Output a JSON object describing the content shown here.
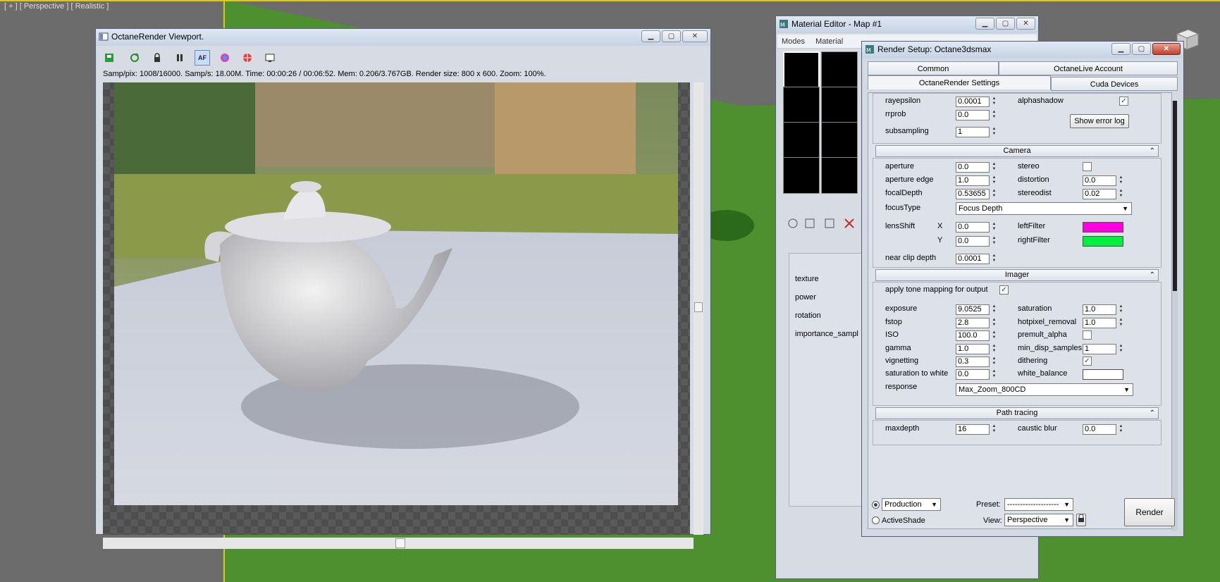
{
  "viewport": {
    "label": "[ + ] [ Perspective ] [ Realistic ]"
  },
  "octane_viewport": {
    "title": "OctaneRender Viewport.",
    "stats": "Samp/pix: 1008/16000.   Samp/s: 18.00M.   Time: 00:00:26 / 00:06:52.   Mem: 0.206/3.767GB.   Render size: 800 x 600.   Zoom: 100%.",
    "toolbar_icons": [
      "save-image-icon",
      "restart-render-icon",
      "lock-icon",
      "pause-icon",
      "autofocus-icon",
      "color-picker-icon",
      "focus-picker-icon",
      "display-settings-icon"
    ],
    "toolbar_labels": {
      "af": "AF"
    }
  },
  "material_editor": {
    "title": "Material Editor - Map #1",
    "menu": [
      "Modes",
      "Material"
    ],
    "params": [
      "texture",
      "power",
      "rotation",
      "importance_sampl"
    ]
  },
  "render_setup": {
    "title": "Render Setup: Octane3dsmax",
    "tabs": {
      "common": "Common",
      "octanelive": "OctaneLive Account",
      "settings": "OctaneRender Settings",
      "cuda": "Cuda Devices"
    },
    "kernel": {
      "rayepsilon": {
        "label": "rayepsilon",
        "value": "0.0001"
      },
      "rrprob": {
        "label": "rrprob",
        "value": "0.0"
      },
      "subsampling": {
        "label": "subsampling",
        "value": "1"
      },
      "alphashadow": {
        "label": "alphashadow",
        "checked": true
      },
      "show_error_log": "Show error log"
    },
    "camera": {
      "title": "Camera",
      "aperture": {
        "label": "aperture",
        "value": "0.0"
      },
      "aperture_edge": {
        "label": "aperture edge",
        "value": "1.0"
      },
      "focal_depth": {
        "label": "focalDepth",
        "value": "0.53655"
      },
      "stereo": {
        "label": "stereo",
        "checked": false
      },
      "distortion": {
        "label": "distortion",
        "value": "0.0"
      },
      "stereodist": {
        "label": "stereodist",
        "value": "0.02"
      },
      "focus_type": {
        "label": "focusType",
        "value": "Focus Depth"
      },
      "lens_shift": {
        "label": "lensShift",
        "x_label": "X",
        "x_value": "0.0",
        "y_label": "Y",
        "y_value": "0.0"
      },
      "left_filter": {
        "label": "leftFilter",
        "color": "#ff00e0"
      },
      "right_filter": {
        "label": "rightFilter",
        "color": "#00f040"
      },
      "near_clip": {
        "label": "near clip depth",
        "value": "0.0001"
      }
    },
    "imager": {
      "title": "Imager",
      "tone_mapping": {
        "label": "apply tone mapping for output",
        "checked": true
      },
      "exposure": {
        "label": "exposure",
        "value": "9.0525"
      },
      "fstop": {
        "label": "fstop",
        "value": "2.8"
      },
      "iso": {
        "label": "ISO",
        "value": "100.0"
      },
      "gamma": {
        "label": "gamma",
        "value": "1.0"
      },
      "vignetting": {
        "label": "vignetting",
        "value": "0.3"
      },
      "sat_white": {
        "label": "saturation to white",
        "value": "0.0"
      },
      "response": {
        "label": "response",
        "value": "Max_Zoom_800CD"
      },
      "saturation": {
        "label": "saturation",
        "value": "1.0"
      },
      "hotpixel": {
        "label": "hotpixel_removal",
        "value": "1.0"
      },
      "premult_alpha": {
        "label": "premult_alpha",
        "checked": false
      },
      "min_disp": {
        "label": "min_disp_samples",
        "value": "1"
      },
      "dithering": {
        "label": "dithering",
        "checked": true
      },
      "white_balance": {
        "label": "white_balance",
        "color": "#ffffff"
      }
    },
    "path_tracing": {
      "title": "Path tracing",
      "maxdepth": {
        "label": "maxdepth",
        "value": "16"
      },
      "caustic_blur": {
        "label": "caustic blur",
        "value": "0.0"
      }
    },
    "footer": {
      "production": "Production",
      "activeshade": "ActiveShade",
      "preset_label": "Preset:",
      "preset_value": "--------------------",
      "view_label": "View:",
      "view_value": "Perspective",
      "render": "Render"
    }
  }
}
